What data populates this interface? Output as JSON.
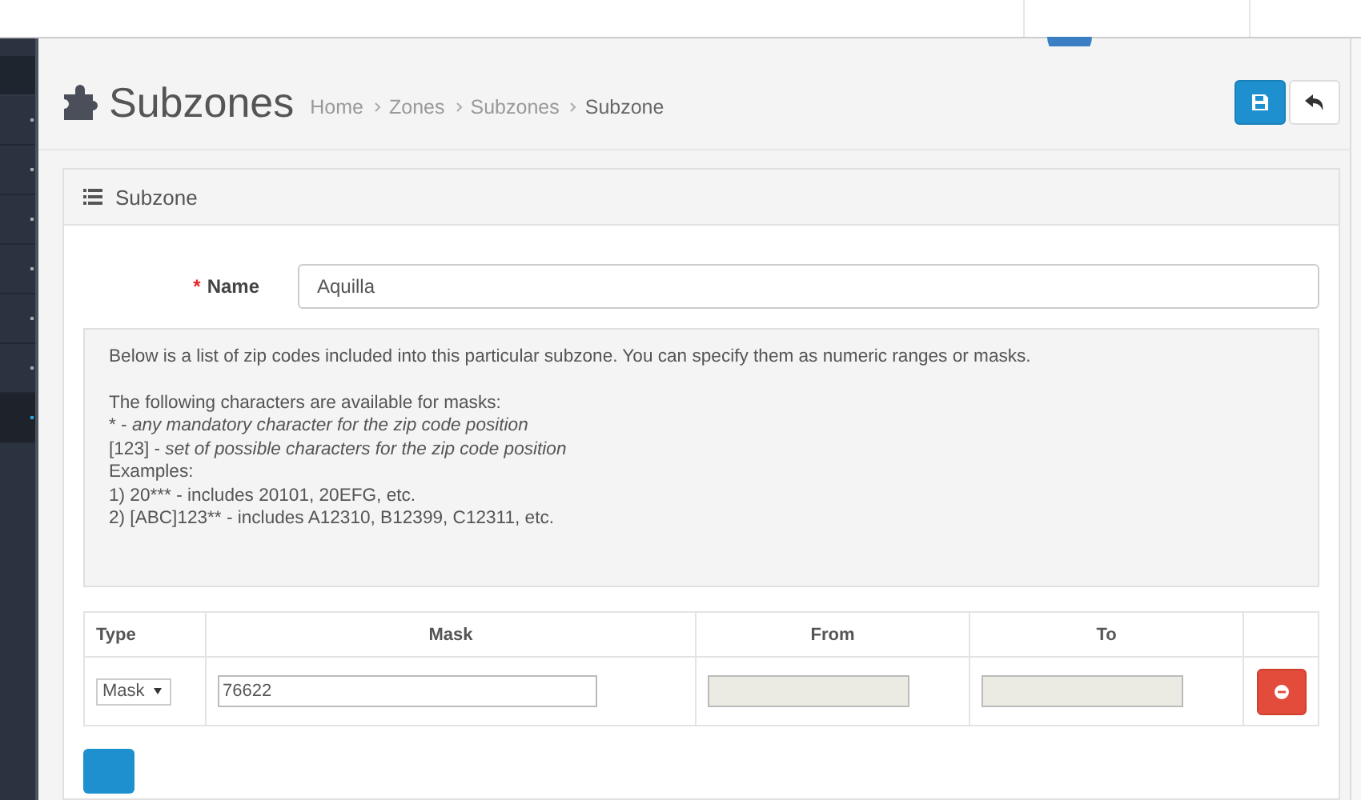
{
  "sidebar": {
    "items": [
      {
        "selected": false
      },
      {
        "selected": false
      },
      {
        "selected": false
      },
      {
        "selected": false
      },
      {
        "selected": false
      },
      {
        "selected": false
      },
      {
        "selected": true
      }
    ]
  },
  "page": {
    "title": "Subzones",
    "breadcrumb": [
      {
        "label": "Home",
        "current": false
      },
      {
        "label": "Zones",
        "current": false
      },
      {
        "label": "Subzones",
        "current": false
      },
      {
        "label": "Subzone",
        "current": true
      }
    ]
  },
  "panel": {
    "title": "Subzone",
    "name_field": {
      "label": "Name",
      "required_mark": "*",
      "value": "Aquilla"
    },
    "info": {
      "intro": "Below is a list of zip codes included into this particular subzone. You can specify them as numeric ranges or masks.",
      "lines": [
        "The following characters are available for masks:",
        "* - *any mandatory character for the zip code position*",
        "[123] - *set of possible characters for the zip code position*",
        "Examples:",
        "1) 20*** - includes 20101, 20EFG, etc.",
        "2) [ABC]123** - includes A12310, B12399, C12311, etc."
      ]
    },
    "table": {
      "columns": [
        "Type",
        "Mask",
        "From",
        "To"
      ],
      "rows": [
        {
          "type": "Mask",
          "mask": "76622",
          "from": {
            "disabled": true
          },
          "to": {
            "disabled": true
          }
        }
      ]
    }
  }
}
